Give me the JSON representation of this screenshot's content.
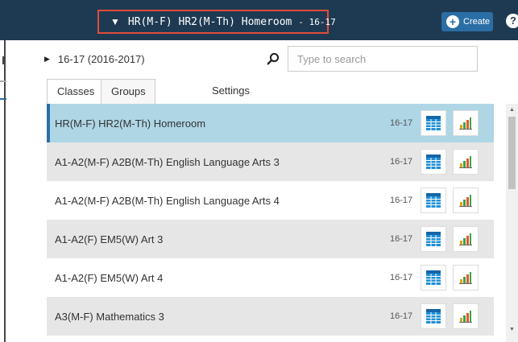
{
  "header": {
    "class_title": "HR(M-F) HR2(M-Th) Homeroom",
    "class_year": "- 16-17",
    "create_label": "Create",
    "help_label": "?",
    "colors": {
      "bar": "#1e3a52",
      "highlight_border": "#e04b3a",
      "create": "#2b6ea5"
    }
  },
  "year_filter": {
    "label": "16-17 (2016-2017)"
  },
  "search": {
    "placeholder": "Type to search",
    "value": ""
  },
  "tabs": [
    {
      "label": "Classes",
      "active": true
    },
    {
      "label": "Groups",
      "active": false
    },
    {
      "label": "Settings",
      "active": false
    }
  ],
  "classes": [
    {
      "name": "HR(M-F) HR2(M-Th) Homeroom",
      "year": "16-17",
      "selected": true
    },
    {
      "name": "A1-A2(M-F) A2B(M-Th) English Language Arts 3",
      "year": "16-17",
      "selected": false
    },
    {
      "name": "A1-A2(M-F) A2B(M-Th) English Language Arts 4",
      "year": "16-17",
      "selected": false
    },
    {
      "name": "A1-A2(F) EM5(W) Art 3",
      "year": "16-17",
      "selected": false
    },
    {
      "name": "A1-A2(F) EM5(W) Art 4",
      "year": "16-17",
      "selected": false
    },
    {
      "name": "A3(M-F) Mathematics 3",
      "year": "16-17",
      "selected": false
    }
  ],
  "icons": {
    "grid": "gradebook-grid-icon",
    "chart": "bar-chart-icon",
    "search": "search-icon"
  }
}
